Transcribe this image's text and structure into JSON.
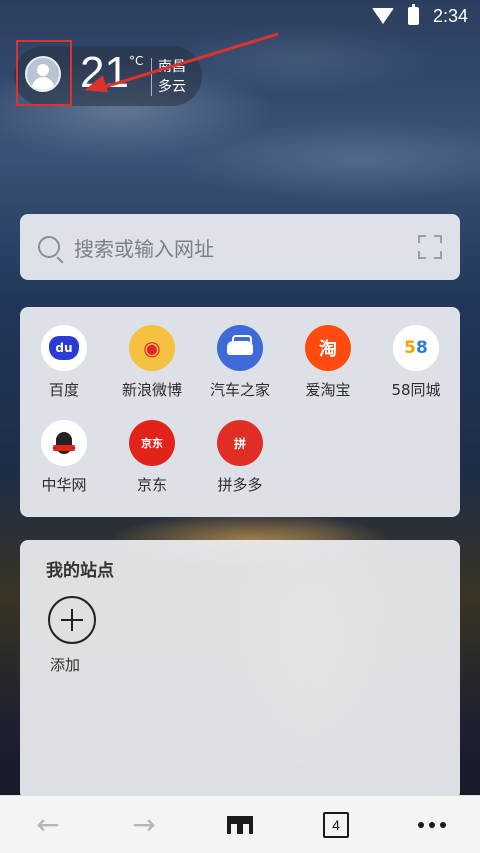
{
  "status_bar": {
    "time": "2:34"
  },
  "weather": {
    "temperature": "21",
    "unit": "°C",
    "city": "南昌",
    "condition": "多云"
  },
  "search": {
    "placeholder": "搜索或输入网址"
  },
  "shortcuts": [
    {
      "label": "百度",
      "icon": "baidu-icon"
    },
    {
      "label": "新浪微博",
      "icon": "weibo-icon"
    },
    {
      "label": "汽车之家",
      "icon": "autohome-icon"
    },
    {
      "label": "爱淘宝",
      "icon": "taobao-icon"
    },
    {
      "label": "58同城",
      "icon": "58-icon"
    },
    {
      "label": "中华网",
      "icon": "china-com-icon"
    },
    {
      "label": "京东",
      "icon": "jd-icon"
    },
    {
      "label": "拼多多",
      "icon": "pinduoduo-icon"
    }
  ],
  "icon_text": {
    "baidu": "du",
    "weibo": "◉",
    "taobao": "淘",
    "n5": "5",
    "n8": "8",
    "jd": "京东",
    "pdd": "拼"
  },
  "my_sites": {
    "title": "我的站点",
    "add_label": "添加"
  },
  "bottom_nav": {
    "tab_count": "4"
  },
  "colors": {
    "annotation": "#e0322c",
    "panel_bg": "#eceef2"
  }
}
